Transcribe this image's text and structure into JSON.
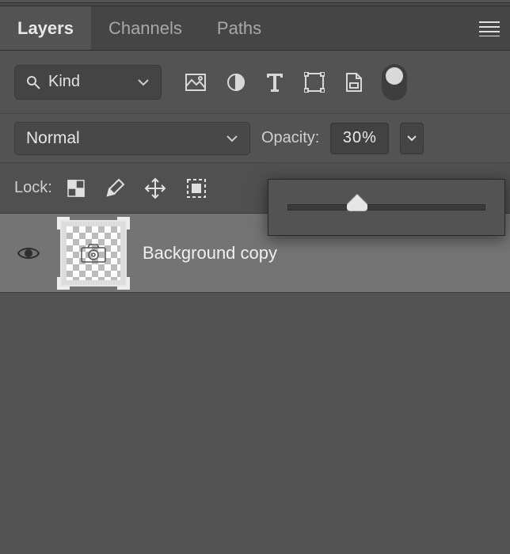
{
  "tabs": {
    "layers": "Layers",
    "channels": "Channels",
    "paths": "Paths",
    "active": "layers"
  },
  "filter": {
    "kind_label": "Kind"
  },
  "blend": {
    "mode": "Normal"
  },
  "opacity": {
    "label": "Opacity:",
    "value": "30%",
    "slider_percent": 30
  },
  "lock": {
    "label": "Lock:"
  },
  "layers": [
    {
      "name": "Background copy",
      "visible": true
    }
  ]
}
